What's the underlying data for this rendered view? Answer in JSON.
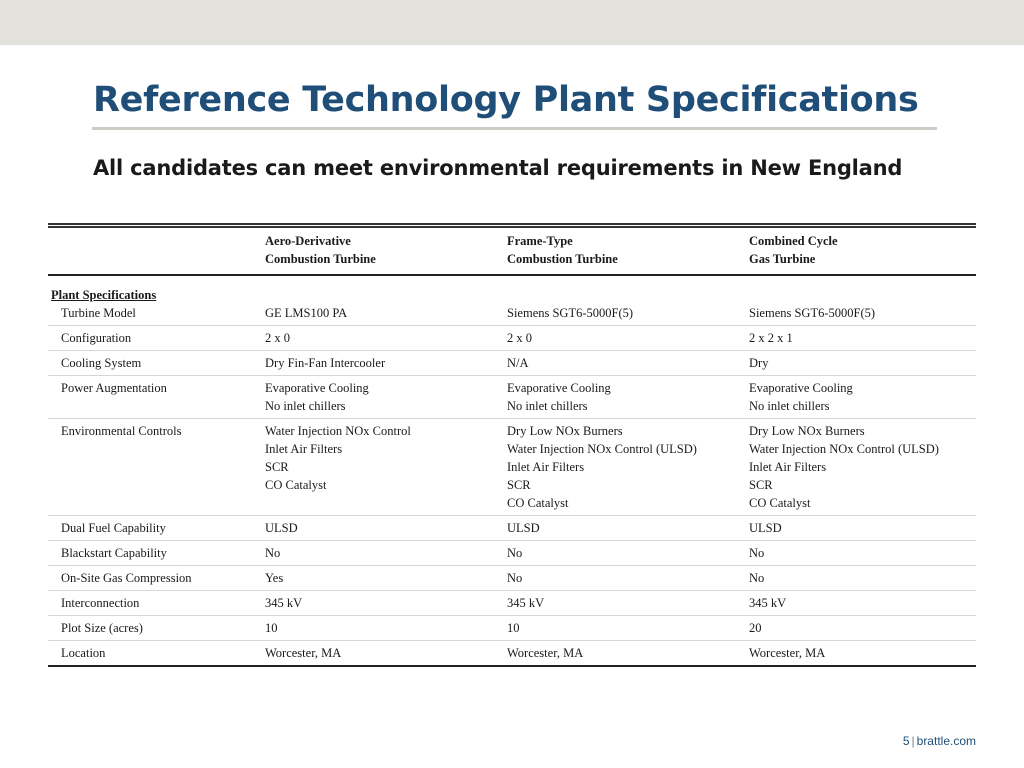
{
  "title": "Reference Technology Plant Specifications",
  "subtitle": "All candidates can meet environmental requirements in New England",
  "table": {
    "columns": [
      [
        "Aero-Derivative",
        "Combustion Turbine"
      ],
      [
        "Frame-Type",
        "Combustion Turbine"
      ],
      [
        "Combined Cycle",
        "Gas Turbine"
      ]
    ],
    "section_label": "Plant Specifications",
    "rows": [
      {
        "label": "Turbine Model",
        "cells": [
          [
            "GE LMS100 PA"
          ],
          [
            "Siemens SGT6-5000F(5)"
          ],
          [
            "Siemens SGT6-5000F(5)"
          ]
        ]
      },
      {
        "label": "Configuration",
        "cells": [
          [
            "2 x 0"
          ],
          [
            "2 x 0"
          ],
          [
            "2 x 2 x 1"
          ]
        ]
      },
      {
        "label": "Cooling System",
        "cells": [
          [
            "Dry Fin-Fan Intercooler"
          ],
          [
            "N/A"
          ],
          [
            "Dry"
          ]
        ]
      },
      {
        "label": "Power Augmentation",
        "cells": [
          [
            "Evaporative Cooling",
            "No inlet chillers"
          ],
          [
            "Evaporative Cooling",
            "No inlet chillers"
          ],
          [
            "Evaporative Cooling",
            "No inlet chillers"
          ]
        ]
      },
      {
        "label": "Environmental Controls",
        "cells": [
          [
            "Water Injection NOx Control",
            "Inlet Air Filters",
            "SCR",
            "CO Catalyst"
          ],
          [
            "Dry Low NOx Burners",
            "Water Injection NOx Control (ULSD)",
            "Inlet Air Filters",
            "SCR",
            "CO Catalyst"
          ],
          [
            "Dry Low NOx Burners",
            "Water Injection NOx Control (ULSD)",
            "Inlet Air Filters",
            "SCR",
            "CO Catalyst"
          ]
        ]
      },
      {
        "label": "Dual Fuel Capability",
        "cells": [
          [
            "ULSD"
          ],
          [
            "ULSD"
          ],
          [
            "ULSD"
          ]
        ]
      },
      {
        "label": "Blackstart Capability",
        "cells": [
          [
            "No"
          ],
          [
            "No"
          ],
          [
            "No"
          ]
        ]
      },
      {
        "label": "On-Site Gas Compression",
        "cells": [
          [
            "Yes"
          ],
          [
            "No"
          ],
          [
            "No"
          ]
        ]
      },
      {
        "label": "Interconnection",
        "cells": [
          [
            "345 kV"
          ],
          [
            "345 kV"
          ],
          [
            "345 kV"
          ]
        ]
      },
      {
        "label": "Plot Size (acres)",
        "cells": [
          [
            "10"
          ],
          [
            "10"
          ],
          [
            "20"
          ]
        ]
      },
      {
        "label": "Location",
        "cells": [
          [
            "Worcester, MA"
          ],
          [
            "Worcester, MA"
          ],
          [
            "Worcester, MA"
          ]
        ]
      }
    ]
  },
  "footer": {
    "page": "5",
    "separator": "|",
    "site": "brattle.com"
  }
}
